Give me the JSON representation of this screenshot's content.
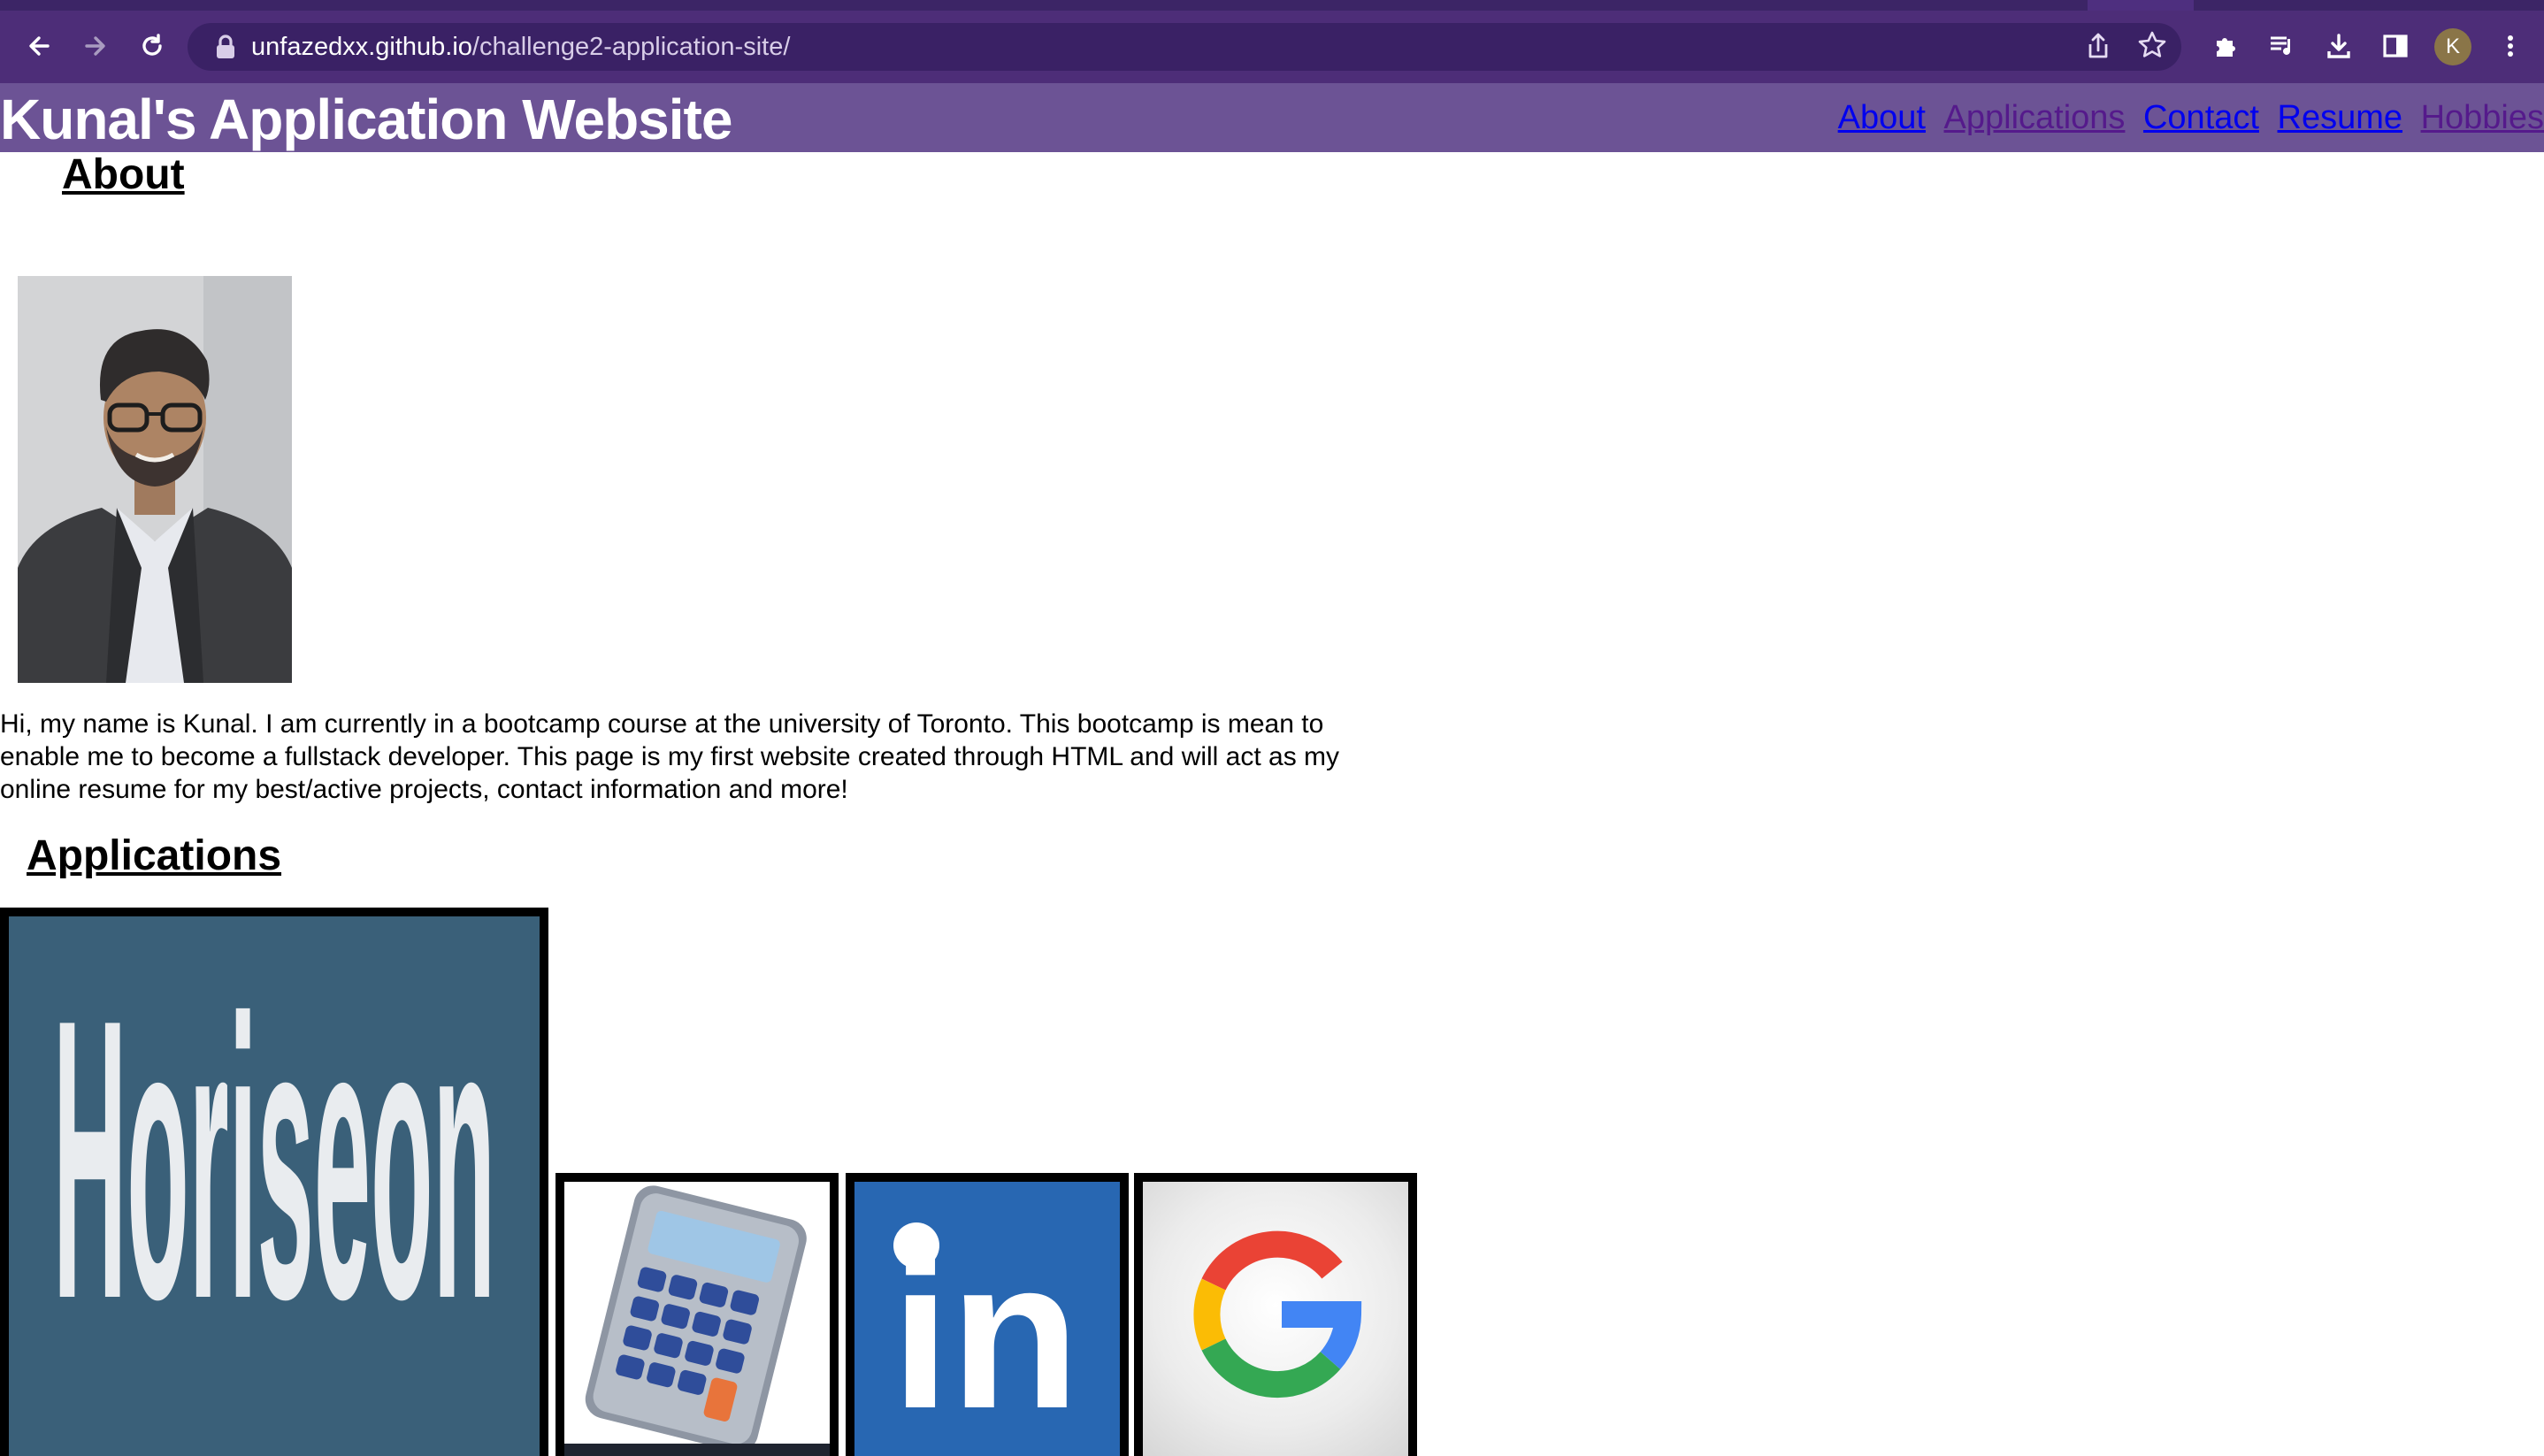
{
  "browser": {
    "url_host": "unfazedxx.github.io",
    "url_path": "/challenge2-application-site/",
    "profile_initial": "K"
  },
  "header": {
    "title": "Kunal's Application Website",
    "nav": [
      {
        "label": "About",
        "state": "unvisited"
      },
      {
        "label": "Applications",
        "state": "visited"
      },
      {
        "label": "Contact",
        "state": "unvisited"
      },
      {
        "label": "Resume",
        "state": "unvisited"
      },
      {
        "label": "Hobbies",
        "state": "visited"
      }
    ]
  },
  "about": {
    "heading": "About",
    "text": "Hi, my name is Kunal. I am currently in a bootcamp course at the university of Toronto. This bootcamp is mean to enable me to become a fullstack developer. This page is my first website created through HTML and will act as my online resume for my best/active projects, contact information and more!"
  },
  "applications": {
    "heading": "Applications",
    "cards": [
      {
        "name": "Horiseon",
        "logo_text": "Horiseon"
      },
      {
        "name": "Calculator"
      },
      {
        "name": "LinkedIn",
        "logo_text": "in"
      },
      {
        "name": "Google",
        "logo_text": "G"
      }
    ]
  },
  "colors": {
    "header_bg": "#6c5395",
    "toolbar_bg": "#4d2d78",
    "link_unvisited": "#0000ee",
    "link_visited": "#551a8b",
    "horiseon_bg": "#3a6079",
    "linkedin_bg": "#2867b2"
  },
  "icons": [
    "back-arrow-icon",
    "forward-arrow-icon",
    "reload-icon",
    "lock-icon",
    "share-icon",
    "star-icon",
    "extensions-icon",
    "media-queue-icon",
    "download-icon",
    "side-panel-icon",
    "kebab-menu-icon"
  ]
}
